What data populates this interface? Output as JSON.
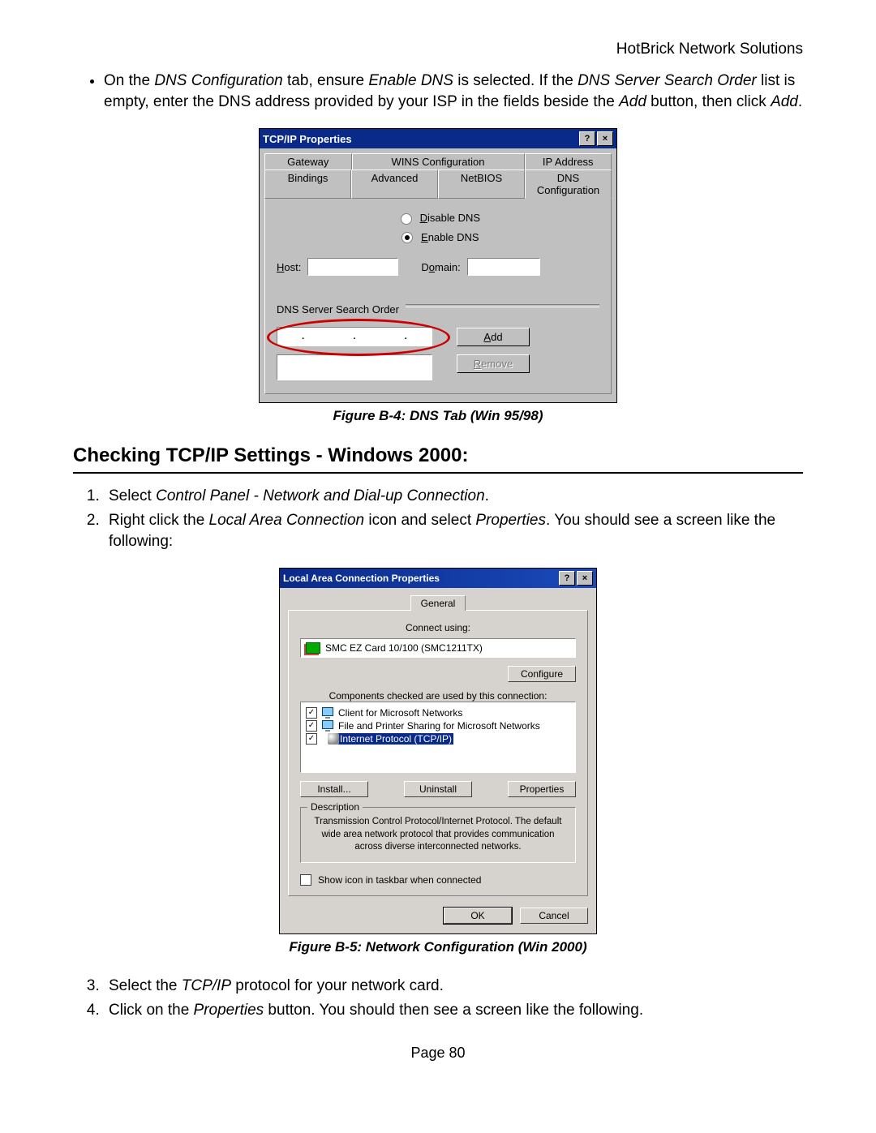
{
  "header": "HotBrick Network Solutions",
  "bullet": {
    "pre": "On the ",
    "i1": "DNS Configuration",
    "mid1": " tab, ensure ",
    "i2": "Enable DNS",
    "mid2": " is selected. If the ",
    "i3": "DNS Server Search Order",
    "mid3": " list is empty, enter the DNS address provided by your ISP in the fields beside the ",
    "i4": "Add",
    "mid4": " button, then click ",
    "i5": "Add",
    "end": "."
  },
  "dlg1": {
    "title": "TCP/IP Properties",
    "help": "?",
    "close": "×",
    "tabs_back": {
      "gateway": "Gateway",
      "wins": "WINS Configuration",
      "ip": "IP Address"
    },
    "tabs_front": {
      "bindings": "Bindings",
      "advanced": "Advanced",
      "netbios": "NetBIOS",
      "dns": "DNS Configuration"
    },
    "disable_pre": "D",
    "disable_rest": "isable DNS",
    "enable_pre": "E",
    "enable_rest": "nable DNS",
    "host_pre": "H",
    "host_rest": "ost:",
    "domain_pre": "D",
    "domain_first": "o",
    "domain_rest": "main:",
    "search_label": "DNS Server Search Order",
    "dot": ".",
    "add_pre": "A",
    "add_rest": "dd",
    "remove_pre": "R",
    "remove_rest": "emove"
  },
  "fig1_caption": "Figure B-4: DNS Tab (Win 95/98)",
  "section_title": "Checking TCP/IP Settings - Windows 2000:",
  "step1": {
    "pre": "Select ",
    "i": "Control Panel - Network and Dial-up Connection",
    "end": "."
  },
  "step2": {
    "pre": "Right click the ",
    "i1": "Local Area Connection",
    "mid": " icon and select ",
    "i2": "Properties",
    "end": ". You should see a screen like the following:"
  },
  "dlg2": {
    "title": "Local Area Connection Properties",
    "help": "?",
    "close": "×",
    "tab": "General",
    "connect_using": "Connect using:",
    "adapter": "SMC EZ Card 10/100 (SMC1211TX)",
    "configure": "Configure",
    "components_label": "Components checked are used by this connection:",
    "comp1": "Client for Microsoft Networks",
    "comp2": "File and Printer Sharing for Microsoft Networks",
    "comp3": "Internet Protocol (TCP/IP)",
    "install": "Install...",
    "uninstall": "Uninstall",
    "properties": "Properties",
    "desc_legend": "Description",
    "desc_text": "Transmission Control Protocol/Internet Protocol. The default wide area network protocol that provides communication across diverse interconnected networks.",
    "show_icon": "Show icon in taskbar when connected",
    "ok": "OK",
    "cancel": "Cancel"
  },
  "fig2_caption": "Figure B-5: Network Configuration (Win 2000)",
  "step3": {
    "pre": "Select the ",
    "i": "TCP/IP",
    "end": " protocol for your network card."
  },
  "step4": {
    "pre": "Click on the ",
    "i": "Properties",
    "end": " button. You should then see a screen like the following."
  },
  "page_num": "Page 80"
}
